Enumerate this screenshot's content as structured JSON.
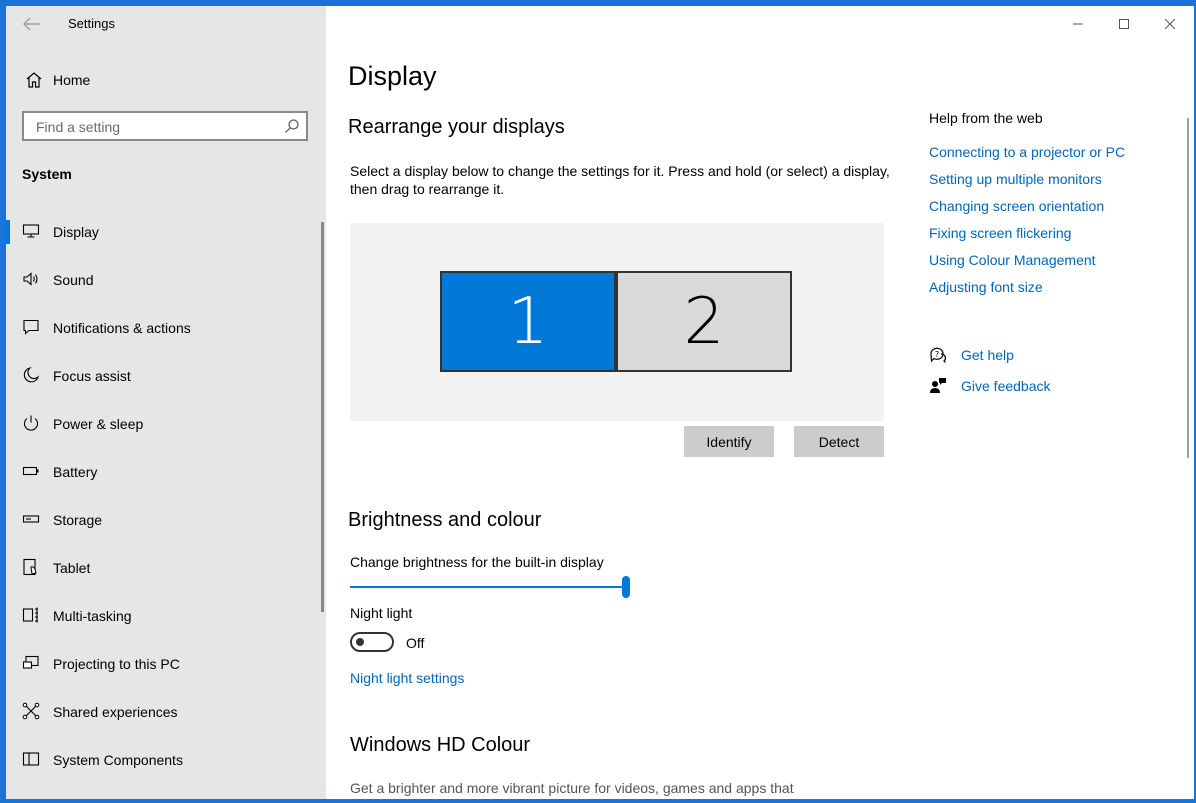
{
  "window": {
    "title": "Settings"
  },
  "sidebar": {
    "home_label": "Home",
    "search_placeholder": "Find a setting",
    "section": "System",
    "items": [
      {
        "label": "Display",
        "icon": "monitor-icon",
        "active": true
      },
      {
        "label": "Sound",
        "icon": "speaker-icon"
      },
      {
        "label": "Notifications & actions",
        "icon": "notification-icon"
      },
      {
        "label": "Focus assist",
        "icon": "moon-icon"
      },
      {
        "label": "Power & sleep",
        "icon": "power-icon"
      },
      {
        "label": "Battery",
        "icon": "battery-icon"
      },
      {
        "label": "Storage",
        "icon": "storage-icon"
      },
      {
        "label": "Tablet",
        "icon": "tablet-icon"
      },
      {
        "label": "Multi-tasking",
        "icon": "multitasking-icon"
      },
      {
        "label": "Projecting to this PC",
        "icon": "projecting-icon"
      },
      {
        "label": "Shared experiences",
        "icon": "shared-icon"
      },
      {
        "label": "System Components",
        "icon": "components-icon"
      }
    ]
  },
  "main": {
    "title": "Display",
    "rearrange": {
      "heading": "Rearrange your displays",
      "description": "Select a display below to change the settings for it. Press and hold (or select) a display, then drag to rearrange it.",
      "monitors": [
        "1",
        "2"
      ],
      "identify_label": "Identify",
      "detect_label": "Detect"
    },
    "brightness": {
      "heading": "Brightness and colour",
      "slider_label": "Change brightness for the built-in display",
      "brightness_value": 100,
      "night_light_label": "Night light",
      "night_light_state": "Off",
      "night_light_settings": "Night light settings"
    },
    "hd_colour": {
      "heading": "Windows HD Colour",
      "description": "Get a brighter and more vibrant picture for videos, games and apps that"
    }
  },
  "help": {
    "title": "Help from the web",
    "links": [
      "Connecting to a projector or PC",
      "Setting up multiple monitors",
      "Changing screen orientation",
      "Fixing screen flickering",
      "Using Colour Management",
      "Adjusting font size"
    ],
    "get_help": "Get help",
    "give_feedback": "Give feedback"
  },
  "colors": {
    "accent": "#0078d7",
    "link": "#0067b8",
    "sidebar_bg": "#e6e6e6",
    "desktop": "#1a73d9"
  }
}
